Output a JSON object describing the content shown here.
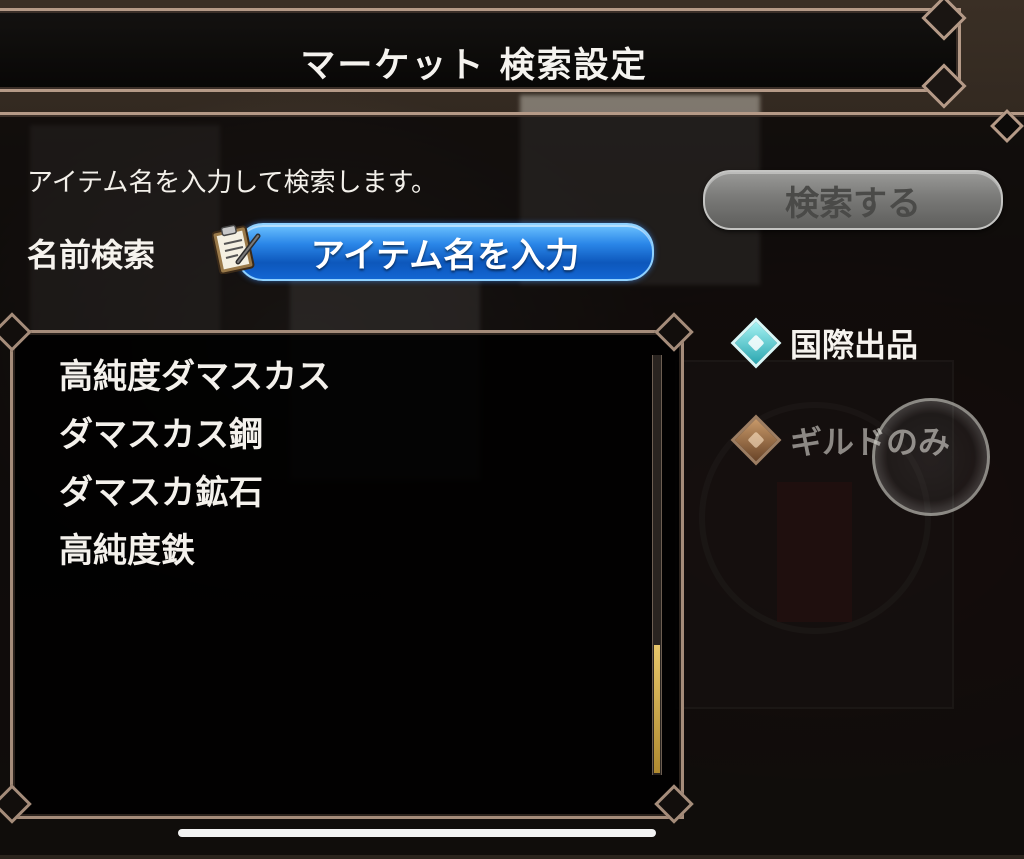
{
  "header": {
    "title": "マーケット 検索設定"
  },
  "search": {
    "hint": "アイテム名を入力して検索します。",
    "button_label": "検索する",
    "name_label": "名前検索",
    "input_label": "アイテム名を入力"
  },
  "results": {
    "items": [
      "高純度ダマスカス",
      "ダマスカス鋼",
      "ダマスカ鉱石",
      "高純度鉄"
    ]
  },
  "options": {
    "international_label": "国際出品",
    "guild_only_label": "ギルドのみ"
  },
  "icons": {
    "clipboard": "clipboard-pen-icon",
    "international": "diamond-sparkle-icon",
    "guild": "diamond-sparkle-icon"
  },
  "colors": {
    "frame": "#b59a87",
    "input_blue": "#1a72dc",
    "button_gray": "#7a7a78",
    "option_active": "#2aa6b0",
    "option_inactive": "#8a5c38"
  }
}
